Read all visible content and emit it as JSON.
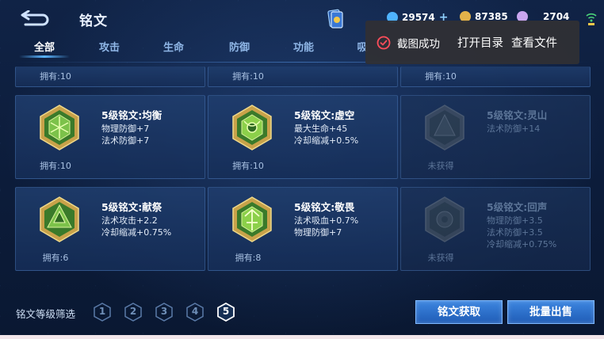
{
  "header": {
    "title": "铭文",
    "currencies": [
      {
        "name": "diamond",
        "value": "29574",
        "color": "#4fb3ff"
      },
      {
        "name": "gold",
        "value": "87385",
        "color": "#e2b24a"
      },
      {
        "name": "crystal",
        "value": "2704",
        "color": "#c9a6f0"
      }
    ]
  },
  "tabs": [
    "全部",
    "攻击",
    "生命",
    "防御",
    "功能",
    "吸"
  ],
  "partial_row": [
    {
      "owned": "拥有:10"
    },
    {
      "owned": "拥有:10"
    },
    {
      "owned": "拥有:10"
    }
  ],
  "cards": [
    {
      "name": "5级铭文:均衡",
      "attrs": [
        "物理防御+7",
        "法术防御+7"
      ],
      "owned": "拥有:10",
      "locked": false
    },
    {
      "name": "5级铭文:虚空",
      "attrs": [
        "最大生命+45",
        "冷却缩减+0.5%"
      ],
      "owned": "拥有:10",
      "locked": false
    },
    {
      "name": "5级铭文:灵山",
      "attrs": [
        "法术防御+14"
      ],
      "owned": "未获得",
      "locked": true
    },
    {
      "name": "5级铭文:献祭",
      "attrs": [
        "法术攻击+2.2",
        "冷却缩减+0.75%"
      ],
      "owned": "拥有:6",
      "locked": false
    },
    {
      "name": "5级铭文:敬畏",
      "attrs": [
        "法术吸血+0.7%",
        "物理防御+7"
      ],
      "owned": "拥有:8",
      "locked": false
    },
    {
      "name": "5级铭文:回声",
      "attrs": [
        "物理防御+3.5",
        "法术防御+3.5",
        "冷却缩减+0.75%"
      ],
      "owned": "未获得",
      "locked": true
    }
  ],
  "filter": {
    "label": "铭文等级筛选",
    "levels": [
      "1",
      "2",
      "3",
      "4",
      "5"
    ],
    "selected": "5"
  },
  "buttons": {
    "acquire": "铭文获取",
    "bulk_sell": "批量出售"
  },
  "toast": {
    "message": "截图成功",
    "open_dir": "打开目录",
    "view_file": "查看文件"
  }
}
